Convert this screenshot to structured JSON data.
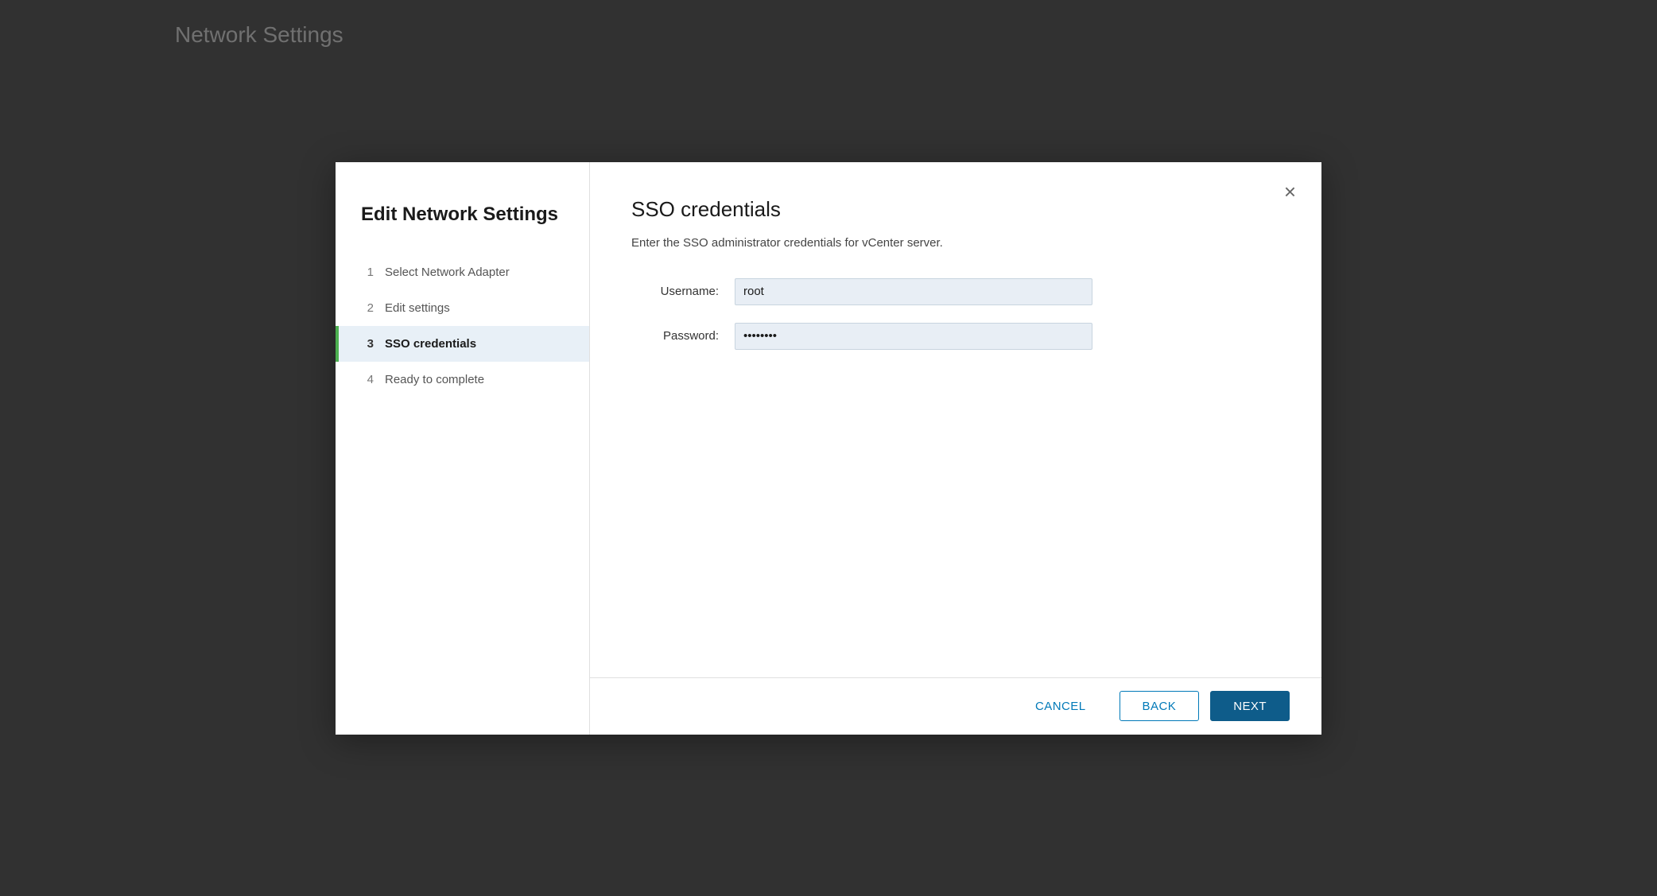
{
  "background": {
    "title": "Network Settings"
  },
  "dialog": {
    "sidebar": {
      "title": "Edit Network Settings",
      "steps": [
        {
          "number": "1",
          "label": "Select Network Adapter",
          "state": "default"
        },
        {
          "number": "2",
          "label": "Edit settings",
          "state": "default"
        },
        {
          "number": "3",
          "label": "SSO credentials",
          "state": "active"
        },
        {
          "number": "4",
          "label": "Ready to complete",
          "state": "default"
        }
      ]
    },
    "content": {
      "title": "SSO credentials",
      "description": "Enter the SSO administrator credentials for vCenter server.",
      "username_label": "Username:",
      "username_value": "root",
      "password_label": "Password:",
      "password_value": "••••••••"
    },
    "footer": {
      "cancel_label": "CANCEL",
      "back_label": "BACK",
      "next_label": "NEXT"
    },
    "close_icon": "×"
  }
}
